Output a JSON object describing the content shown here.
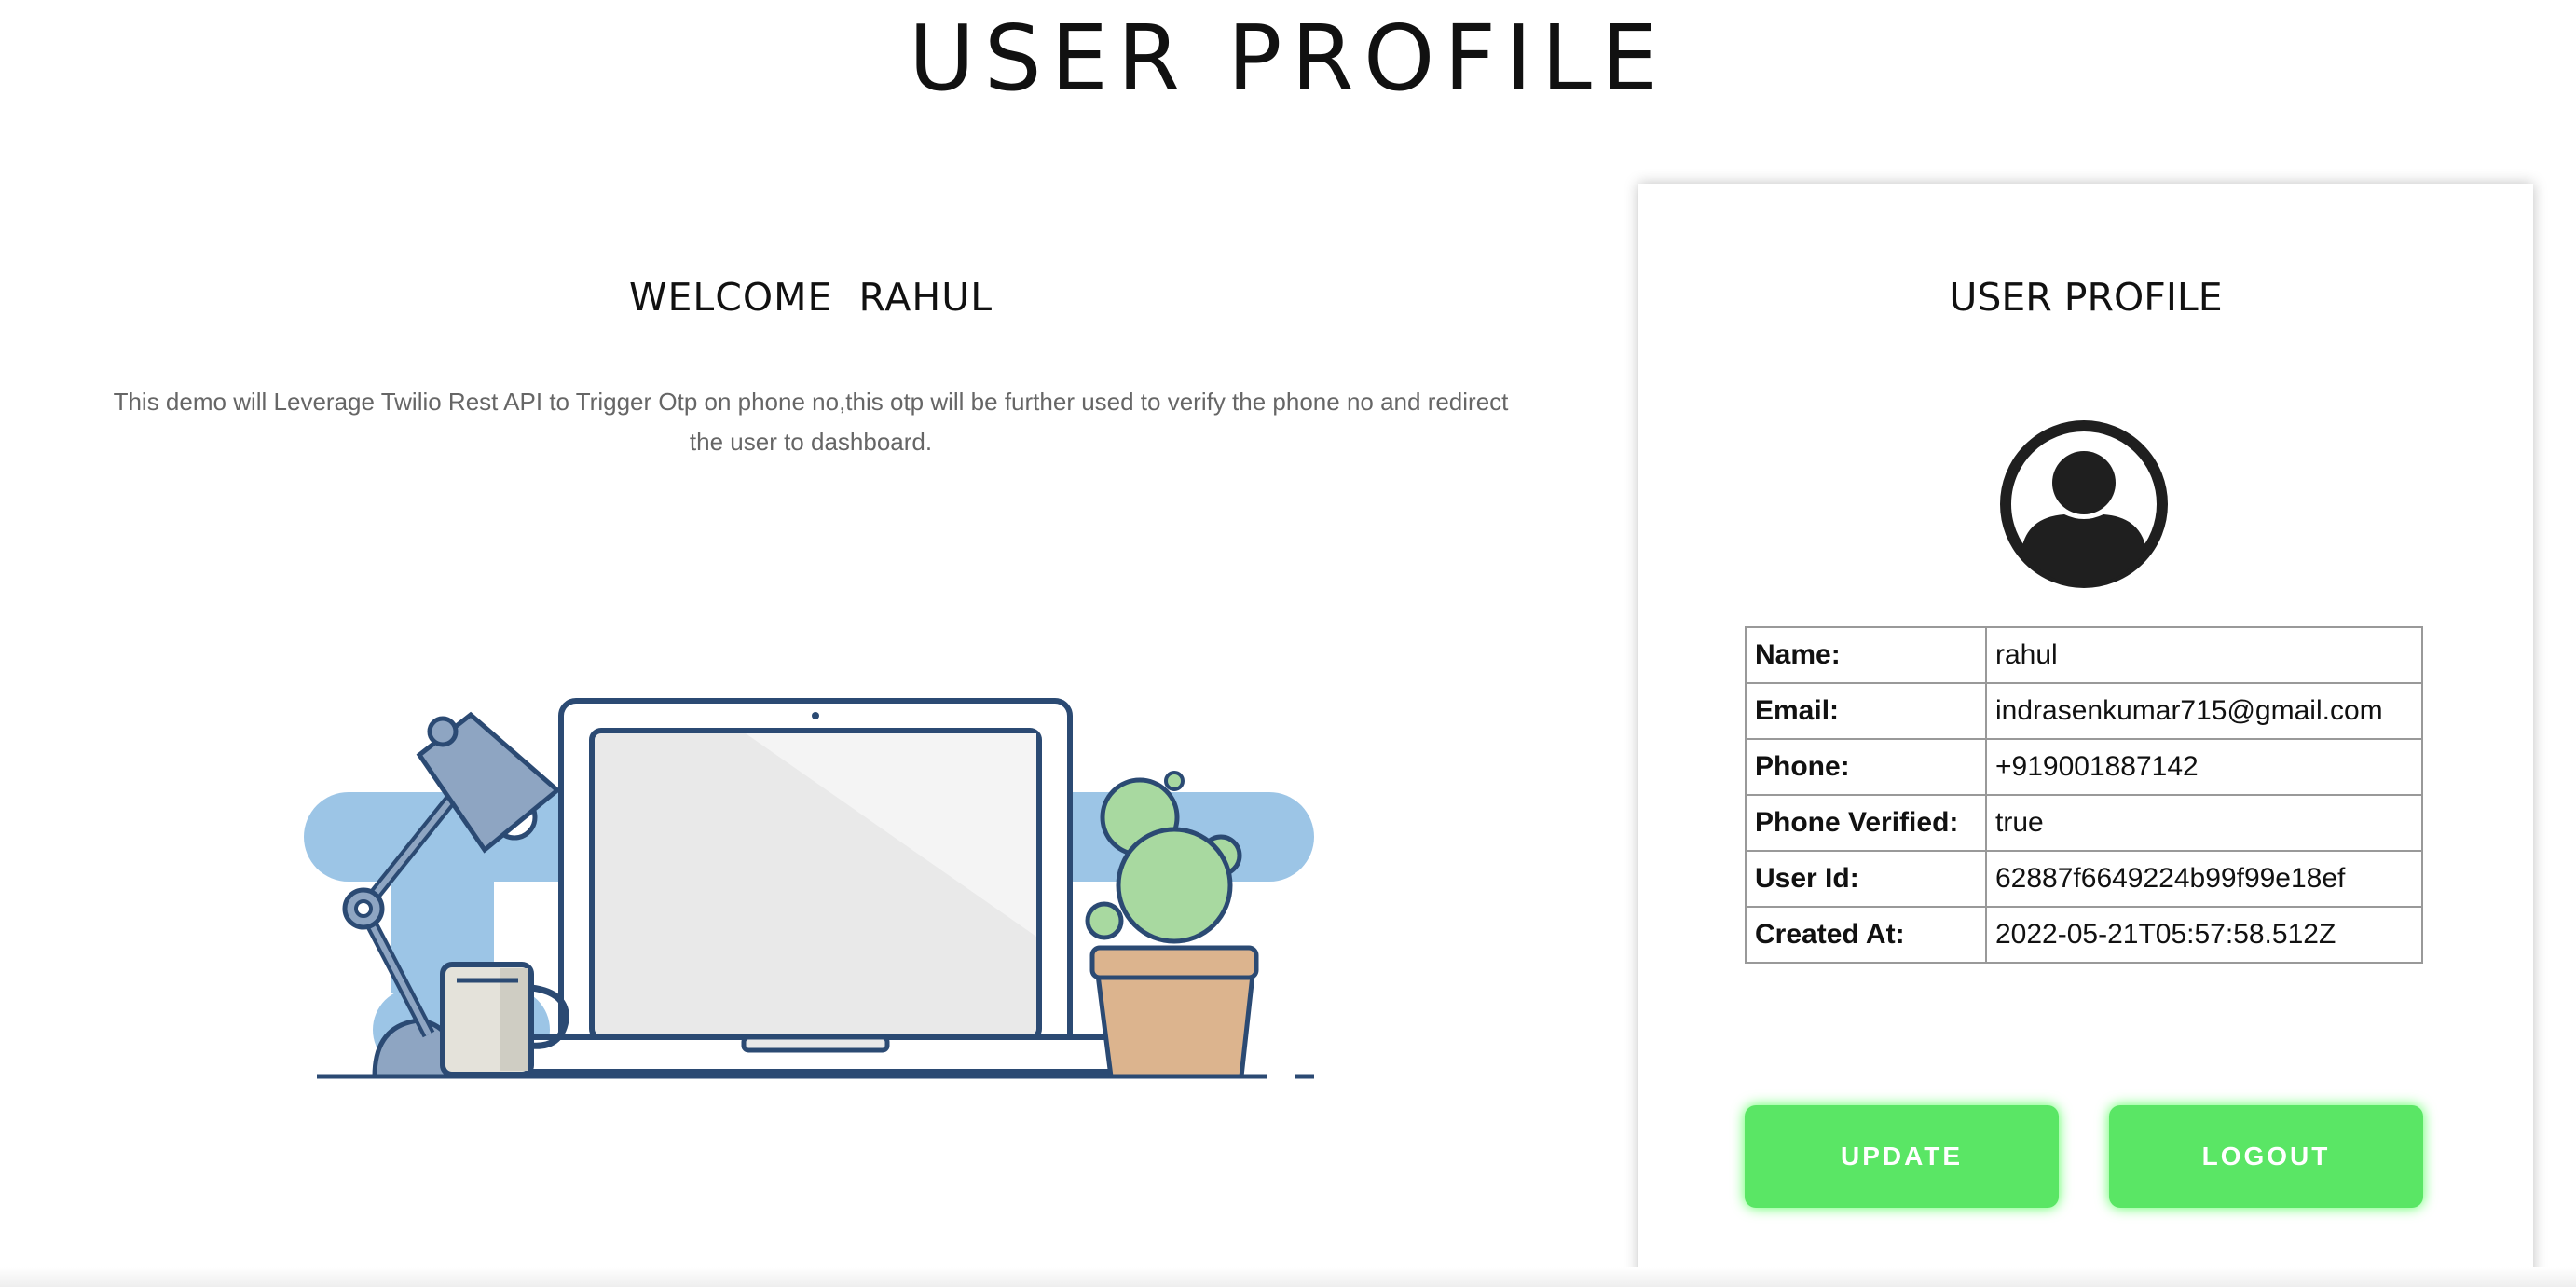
{
  "page": {
    "title": "USER PROFILE"
  },
  "welcome": {
    "title": "WELCOME  RAHUL",
    "description": "This demo will Leverage Twilio Rest API to Trigger Otp on phone no,this otp will be further used to verify the phone no and redirect the user to dashboard."
  },
  "illustration": {
    "icon": "desk-laptop-illustration"
  },
  "profile_card": {
    "title": "USER PROFILE",
    "avatar_icon": "user-avatar-icon",
    "fields": [
      {
        "label": "Name:",
        "value": "rahul"
      },
      {
        "label": "Email:",
        "value": "indrasenkumar715@gmail.com"
      },
      {
        "label": "Phone:",
        "value": "+919001887142"
      },
      {
        "label": "Phone Verified:",
        "value": "true"
      },
      {
        "label": "User Id:",
        "value": "62887f6649224b99f99e18ef"
      },
      {
        "label": "Created At:",
        "value": "2022-05-21T05:57:58.512Z"
      }
    ],
    "update_label": "UPDATE",
    "logout_label": "LOGOUT"
  },
  "colors": {
    "button_green": "#5ae665",
    "illustration_blue": "#9cc5e6",
    "outline_navy": "#2b4a73",
    "cactus_green": "#a8d9a0",
    "pot_tan": "#dcb48e"
  }
}
